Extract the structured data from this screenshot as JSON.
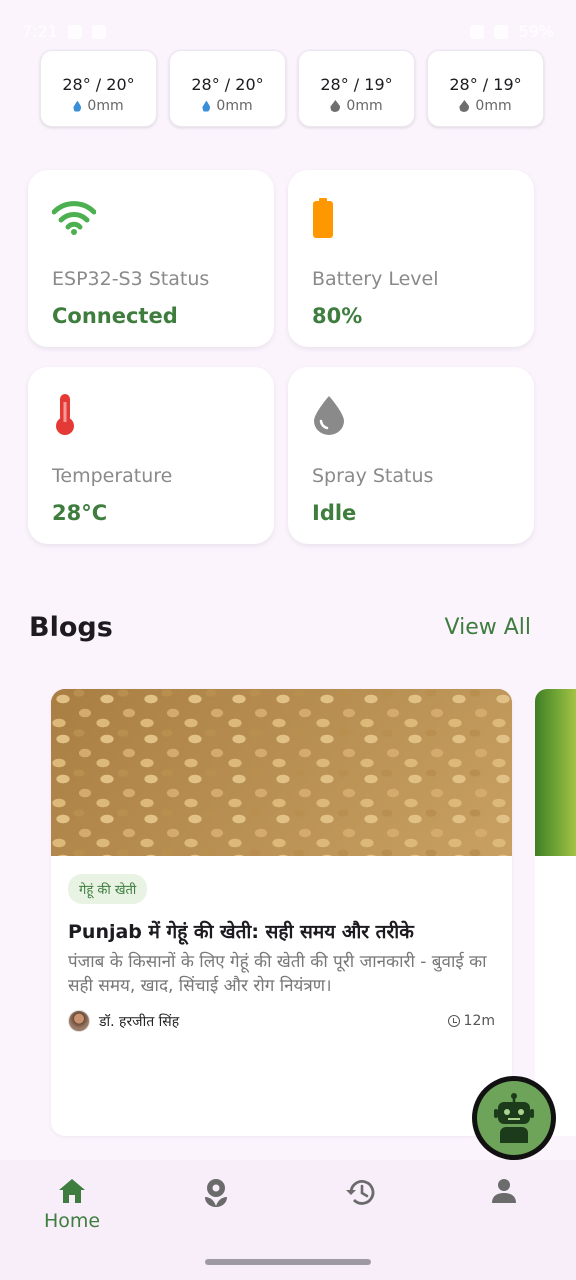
{
  "status_bar": {
    "time": "7:21",
    "battery": "59%"
  },
  "weather": [
    {
      "temp": "28° / 20°",
      "rain": "0mm",
      "icon": "rain-drop-blue-icon"
    },
    {
      "temp": "28° / 20°",
      "rain": "0mm",
      "icon": "rain-drop-blue-icon"
    },
    {
      "temp": "28° / 19°",
      "rain": "0mm",
      "icon": "water-drop-icon"
    },
    {
      "temp": "28° / 19°",
      "rain": "0mm",
      "icon": "water-drop-icon"
    }
  ],
  "device_status": [
    {
      "label": "ESP32-S3 Status",
      "value": "Connected",
      "icon": "wifi-icon",
      "icon_color": "#4caf50"
    },
    {
      "label": "Battery Level",
      "value": "80%",
      "icon": "battery-icon",
      "icon_color": "#ff9800"
    },
    {
      "label": "Temperature",
      "value": "28°C",
      "icon": "thermometer-icon",
      "icon_color": "#e53935"
    },
    {
      "label": "Spray Status",
      "value": "Idle",
      "icon": "water-drop-icon",
      "icon_color": "#8a8a8a"
    }
  ],
  "blogs": {
    "title": "Blogs",
    "view_all": "View All",
    "items": [
      {
        "tag": "गेहूं की खेती",
        "title": "Punjab में गेहूं की खेती: सही समय और तरीके",
        "description": "पंजाब के किसानों के लिए गेहूं की खेती की पूरी जानकारी - बुवाई का सही समय, खाद, सिंचाई और रोग नियंत्रण।",
        "author": "डॉ. हरजीत सिंह",
        "read_time": "12m"
      }
    ]
  },
  "nav": {
    "items": [
      {
        "label": "Home",
        "icon": "home-icon",
        "active": true
      },
      {
        "label": "",
        "icon": "flower-icon",
        "active": false
      },
      {
        "label": "",
        "icon": "history-icon",
        "active": false
      },
      {
        "label": "",
        "icon": "profile-icon",
        "active": false
      }
    ]
  },
  "colors": {
    "accent": "#3e7d3e",
    "background": "#fcf4fd",
    "card": "#ffffff"
  }
}
